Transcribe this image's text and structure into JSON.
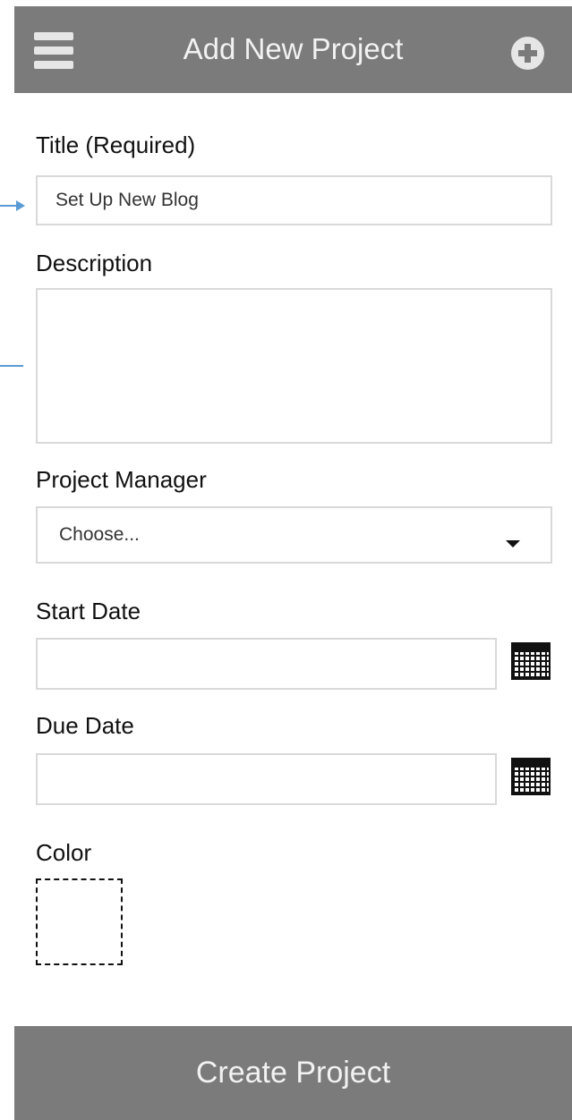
{
  "header": {
    "title": "Add New Project",
    "menu_icon": "hamburger-menu-icon",
    "add_icon": "plus-circle-icon"
  },
  "form": {
    "title_label": "Title (Required)",
    "title_value": "Set Up New Blog",
    "description_label": "Description",
    "description_value": "",
    "manager_label": "Project Manager",
    "manager_selected": "Choose...",
    "start_date_label": "Start Date",
    "start_date_value": "",
    "due_date_label": "Due Date",
    "due_date_value": "",
    "color_label": "Color",
    "calendar_icon": "calendar-icon"
  },
  "footer": {
    "create_label": "Create Project"
  },
  "colors": {
    "header_bg": "#7b7b7b",
    "field_border": "#d9d9d9",
    "annotation_arrow": "#5b9bd5"
  }
}
